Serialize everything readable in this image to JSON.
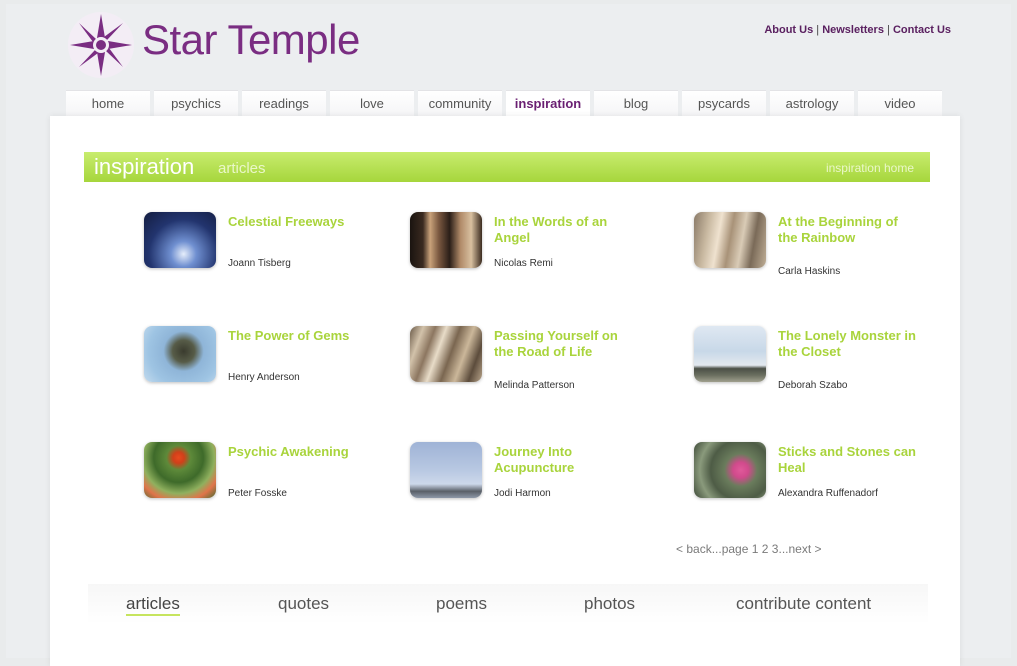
{
  "header": {
    "brand": "Star Temple",
    "links": [
      "About Us",
      "Newsletters",
      "Contact Us"
    ],
    "separator": "|"
  },
  "nav": {
    "tabs": [
      "home",
      "psychics",
      "readings",
      "love",
      "community",
      "inspiration",
      "blog",
      "psycards",
      "astrology",
      "video"
    ],
    "active_index": 5
  },
  "section": {
    "title_main": "inspiration",
    "title_sub": "articles",
    "right_text": "inspiration home"
  },
  "articles": [
    {
      "title": "Celestial Freeways",
      "author": "Joann Tisberg"
    },
    {
      "title": "In the Words of an Angel",
      "author": "Nicolas Remi"
    },
    {
      "title": "At the Beginning of the Rainbow",
      "author": "Carla Haskins"
    },
    {
      "title": "The Power of Gems",
      "author": "Henry Anderson"
    },
    {
      "title": "Passing Yourself on the Road of Life",
      "author": "Melinda Patterson"
    },
    {
      "title": "The Lonely Monster in the Closet",
      "author": "Deborah Szabo"
    },
    {
      "title": "Psychic Awakening",
      "author": "Peter Fosske"
    },
    {
      "title": "Journey Into Acupuncture",
      "author": "Jodi Harmon"
    },
    {
      "title": "Sticks and Stones can Heal",
      "author": "Alexandra Ruffenadorf"
    }
  ],
  "pagination": {
    "back": "< back...page",
    "pages": [
      "1",
      "2",
      "3"
    ],
    "next": "...next >"
  },
  "subnav": {
    "items": [
      "articles",
      "quotes",
      "poems",
      "photos",
      "contribute content"
    ],
    "active_index": 0
  },
  "colors": {
    "brand_purple": "#7a2d82",
    "accent_green": "#a9d43c",
    "background": "#eceef0"
  }
}
